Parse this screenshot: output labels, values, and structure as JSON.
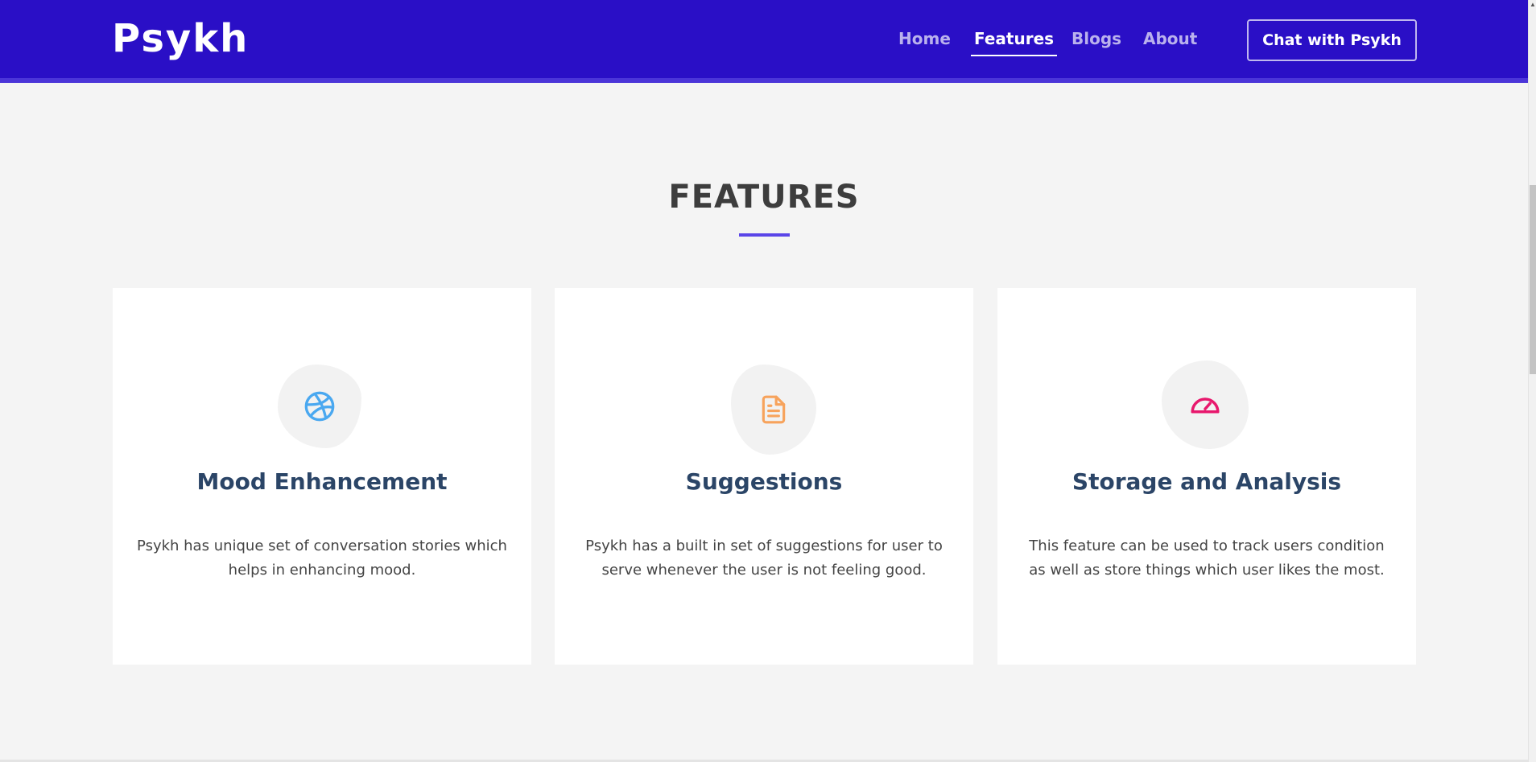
{
  "header": {
    "brand": "Psykh",
    "nav": [
      {
        "label": "Home",
        "active": false
      },
      {
        "label": "Features",
        "active": true
      },
      {
        "label": "Blogs",
        "active": false
      },
      {
        "label": "About",
        "active": false
      }
    ],
    "cta_label": "Chat with Psykh"
  },
  "features": {
    "title": "FEATURES",
    "cards": [
      {
        "icon": "dribbble-icon",
        "icon_color": "#4aa8f0",
        "title": "Mood Enhancement",
        "description": "Psykh has unique set of conversation stories which helps in enhancing mood."
      },
      {
        "icon": "file-text-icon",
        "icon_color": "#f7a35c",
        "title": "Suggestions",
        "description": "Psykh has a built in set of suggestions for user to serve whenever the user is not feeling good."
      },
      {
        "icon": "speedometer-icon",
        "icon_color": "#e8186d",
        "title": "Storage and Analysis",
        "description": "This feature can be used to track users condition as well as store things which user likes the most."
      }
    ]
  },
  "colors": {
    "header_bg": "#2a0fc6",
    "accent": "#5a45e8",
    "page_bg": "#f4f4f4",
    "card_title": "#2b4567"
  }
}
